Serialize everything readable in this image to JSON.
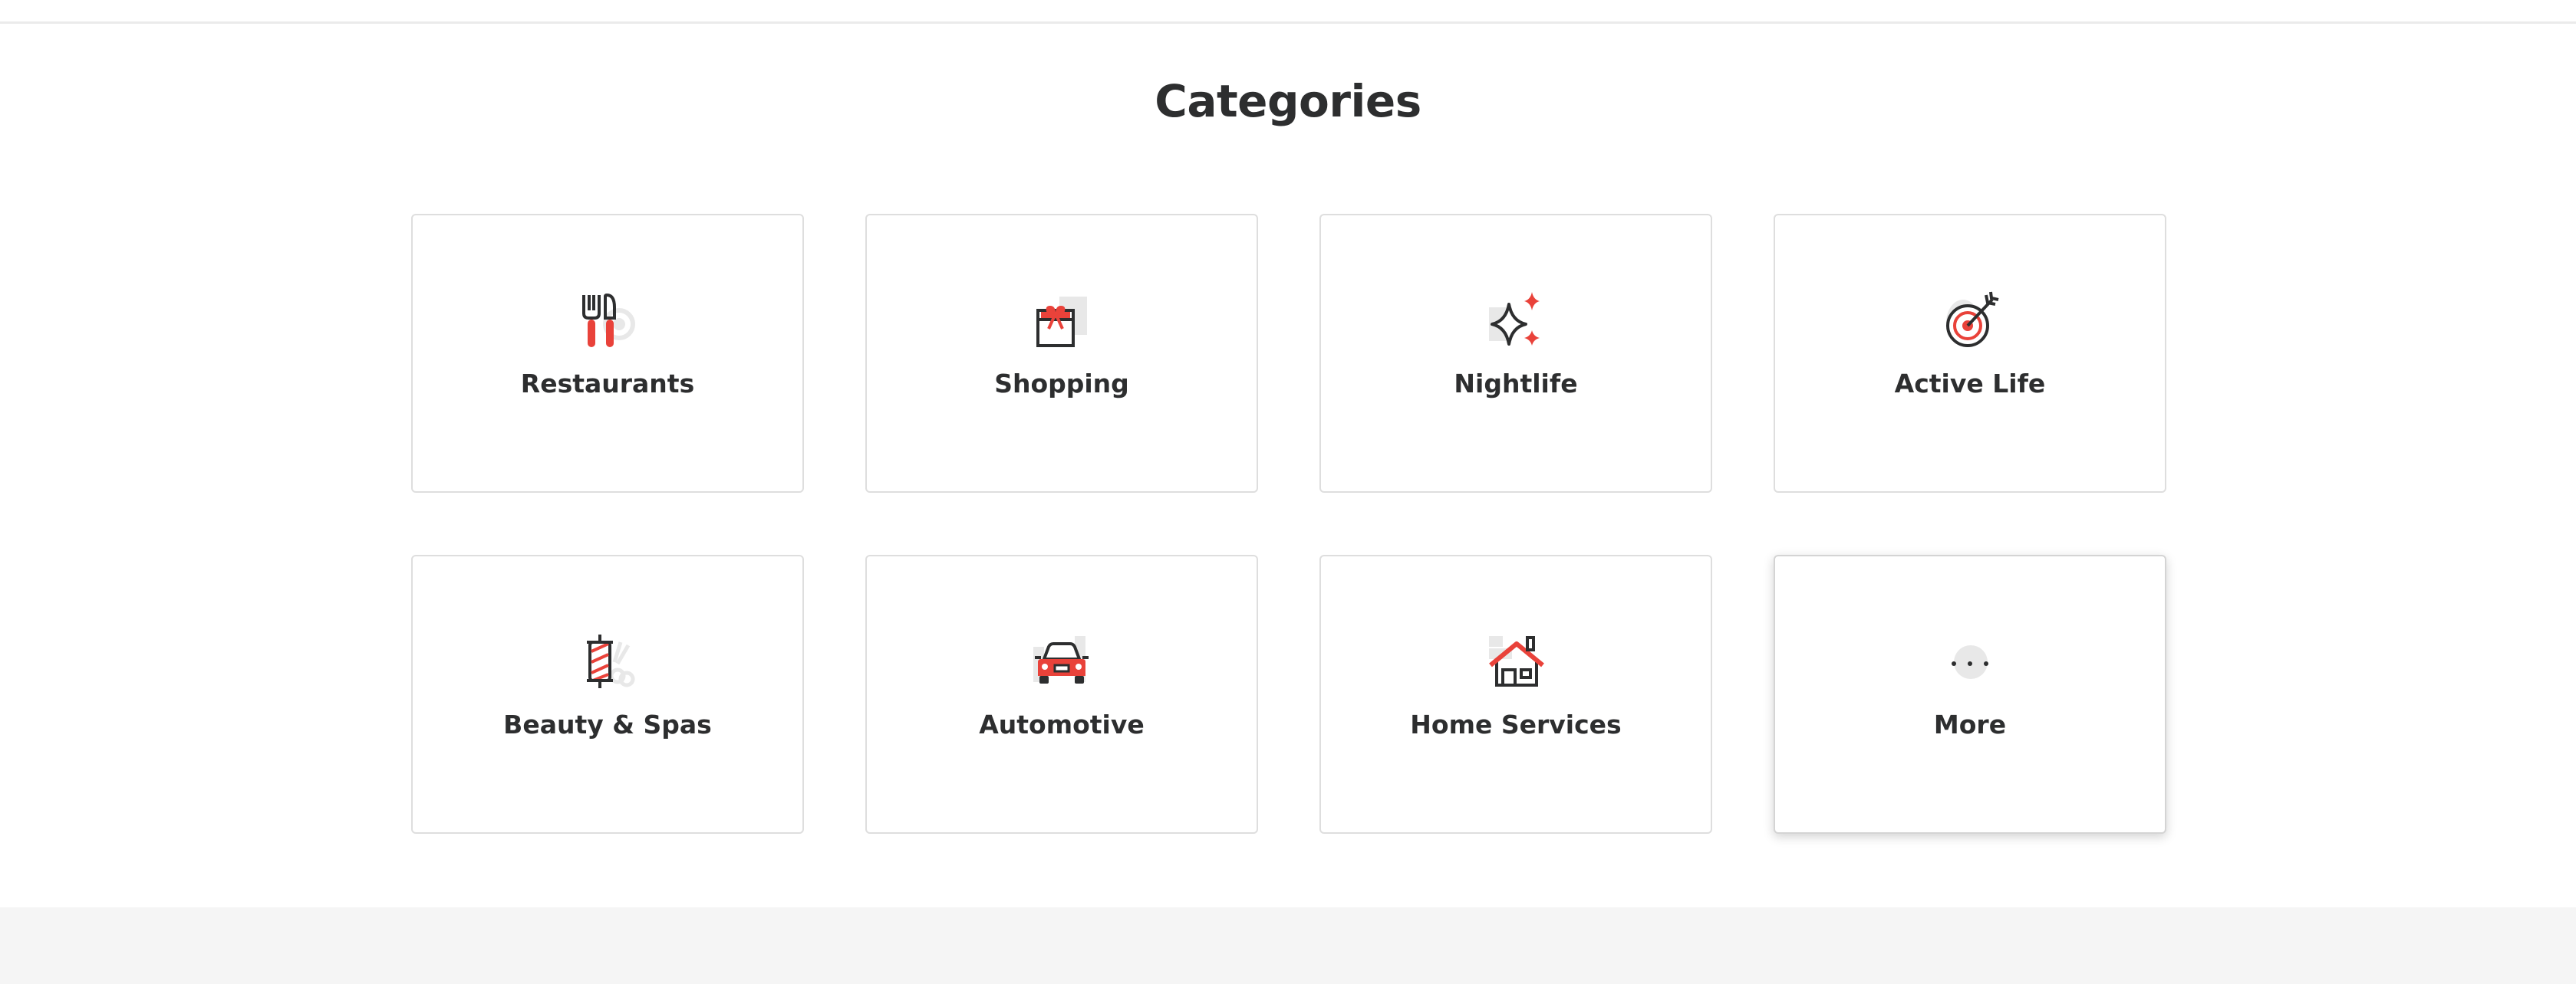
{
  "section": {
    "title": "Categories"
  },
  "categories": [
    {
      "label": "Restaurants",
      "icon": "fork-knife-icon"
    },
    {
      "label": "Shopping",
      "icon": "gift-bag-icon"
    },
    {
      "label": "Nightlife",
      "icon": "sparkle-icon"
    },
    {
      "label": "Active Life",
      "icon": "target-icon"
    },
    {
      "label": "Beauty & Spas",
      "icon": "barber-pole-icon"
    },
    {
      "label": "Automotive",
      "icon": "car-icon"
    },
    {
      "label": "Home Services",
      "icon": "house-icon"
    },
    {
      "label": "More",
      "icon": "more-dots-icon"
    }
  ],
  "colors": {
    "accent": "#e9423a",
    "ink": "#2d2e2f",
    "ghost": "#e8e8e8",
    "card_border": "#dedede",
    "footer_band": "#f5f5f5"
  }
}
